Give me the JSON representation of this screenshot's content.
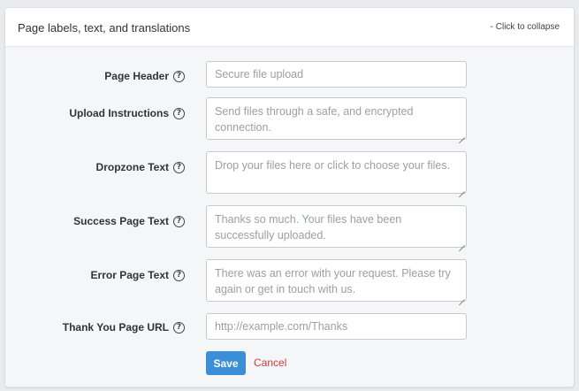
{
  "panel": {
    "title": "Page labels, text, and translations",
    "collapse_label": "- Click to collapse"
  },
  "help_icon": "?",
  "fields": [
    {
      "label": "Page Header",
      "type": "input",
      "value": "",
      "placeholder": "Secure file upload"
    },
    {
      "label": "Upload Instructions",
      "type": "textarea",
      "value": "",
      "placeholder": "Send files through a safe, and encrypted connection."
    },
    {
      "label": "Dropzone Text",
      "type": "textarea",
      "value": "",
      "placeholder": "Drop your files here or click to choose your files."
    },
    {
      "label": "Success Page Text",
      "type": "textarea",
      "value": "",
      "placeholder": "Thanks so much. Your files have been successfully uploaded."
    },
    {
      "label": "Error Page Text",
      "type": "textarea",
      "value": "",
      "placeholder": "There was an error with your request. Please try again or get in touch with us."
    },
    {
      "label": "Thank You Page URL",
      "type": "input",
      "value": "",
      "placeholder": "http://example.com/Thanks"
    }
  ],
  "actions": {
    "save_label": "Save",
    "cancel_label": "Cancel"
  },
  "colors": {
    "accent": "#3a8fd8",
    "cancel": "#cc3b3b"
  }
}
